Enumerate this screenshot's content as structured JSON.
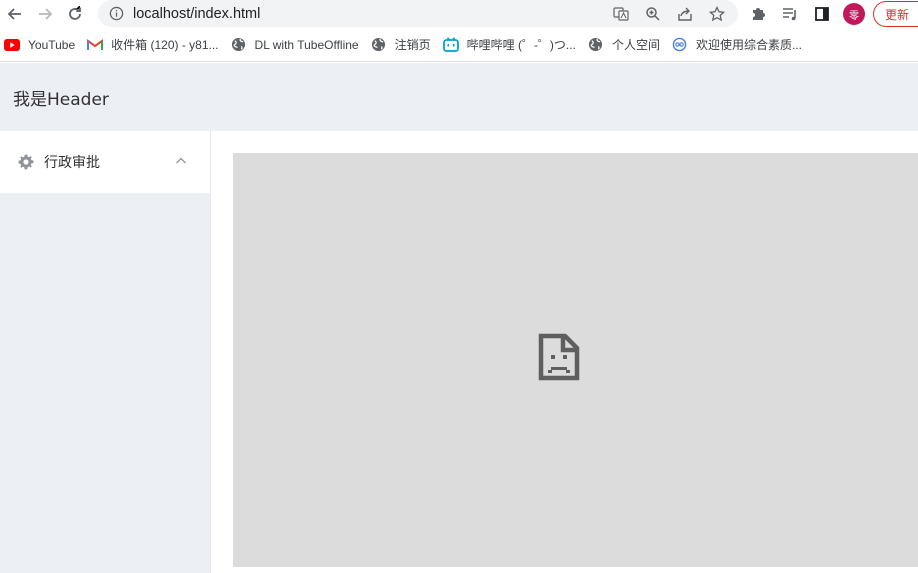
{
  "browser": {
    "url": "localhost/index.html",
    "profile_initial": "零",
    "update_label": "更新",
    "bookmarks": [
      {
        "label": "YouTube",
        "icon": "youtube-icon"
      },
      {
        "label": "收件箱 (120) - y81...",
        "icon": "gmail-icon"
      },
      {
        "label": "DL with TubeOffline",
        "icon": "globe-icon"
      },
      {
        "label": "注销页",
        "icon": "globe-icon"
      },
      {
        "label": "哔哩哔哩 (゜-゜)つ...",
        "icon": "bilibili-icon"
      },
      {
        "label": "个人空间",
        "icon": "globe-icon"
      },
      {
        "label": "欢迎使用综合素质...",
        "icon": "site-icon"
      }
    ]
  },
  "page": {
    "header_title": "我是Header",
    "menu": {
      "submenu_label": "行政审批",
      "expanded": true
    },
    "main": {
      "content_state": "broken-document"
    }
  },
  "colors": {
    "header_bg": "#eceff4",
    "aside_bg": "#eceff4",
    "iframe_bg": "#dcdcdc",
    "update_red": "#d93025",
    "avatar_bg": "#c2185b"
  }
}
